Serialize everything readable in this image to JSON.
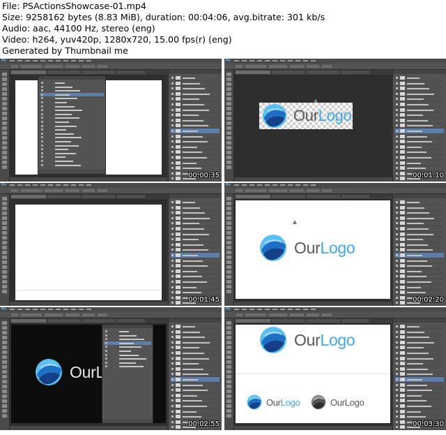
{
  "header": {
    "file": "File: PSActionsShowcase-01.mp4",
    "size": "Size: 9258162 bytes (8.83 MiB), duration: 00:04:06, avg.bitrate: 301 kb/s",
    "audio": "Audio: aac, 44100 Hz, stereo (eng)",
    "video": "Video: h264, yuv420p, 1280x720, 15.00 fps(r) (eng)",
    "generator": "Generated by Thumbnail me"
  },
  "app": {
    "logo_text": "Ps"
  },
  "logo": {
    "our": "Our",
    "logo": "Logo"
  },
  "frames": [
    {
      "timestamp": "00:00:35",
      "scene": "actions-panel"
    },
    {
      "timestamp": "00:01:10",
      "scene": "logo-transparent"
    },
    {
      "timestamp": "00:01:45",
      "scene": "blank-canvas"
    },
    {
      "timestamp": "00:02:20",
      "scene": "logo-white"
    },
    {
      "timestamp": "00:02:55",
      "scene": "logo-dark-actions"
    },
    {
      "timestamp": "00:03:30",
      "scene": "logo-variants"
    }
  ],
  "colors": {
    "accent_blue": "#3fa8e6",
    "ps_gray": "#535353",
    "selection": "#5d7ea8"
  }
}
